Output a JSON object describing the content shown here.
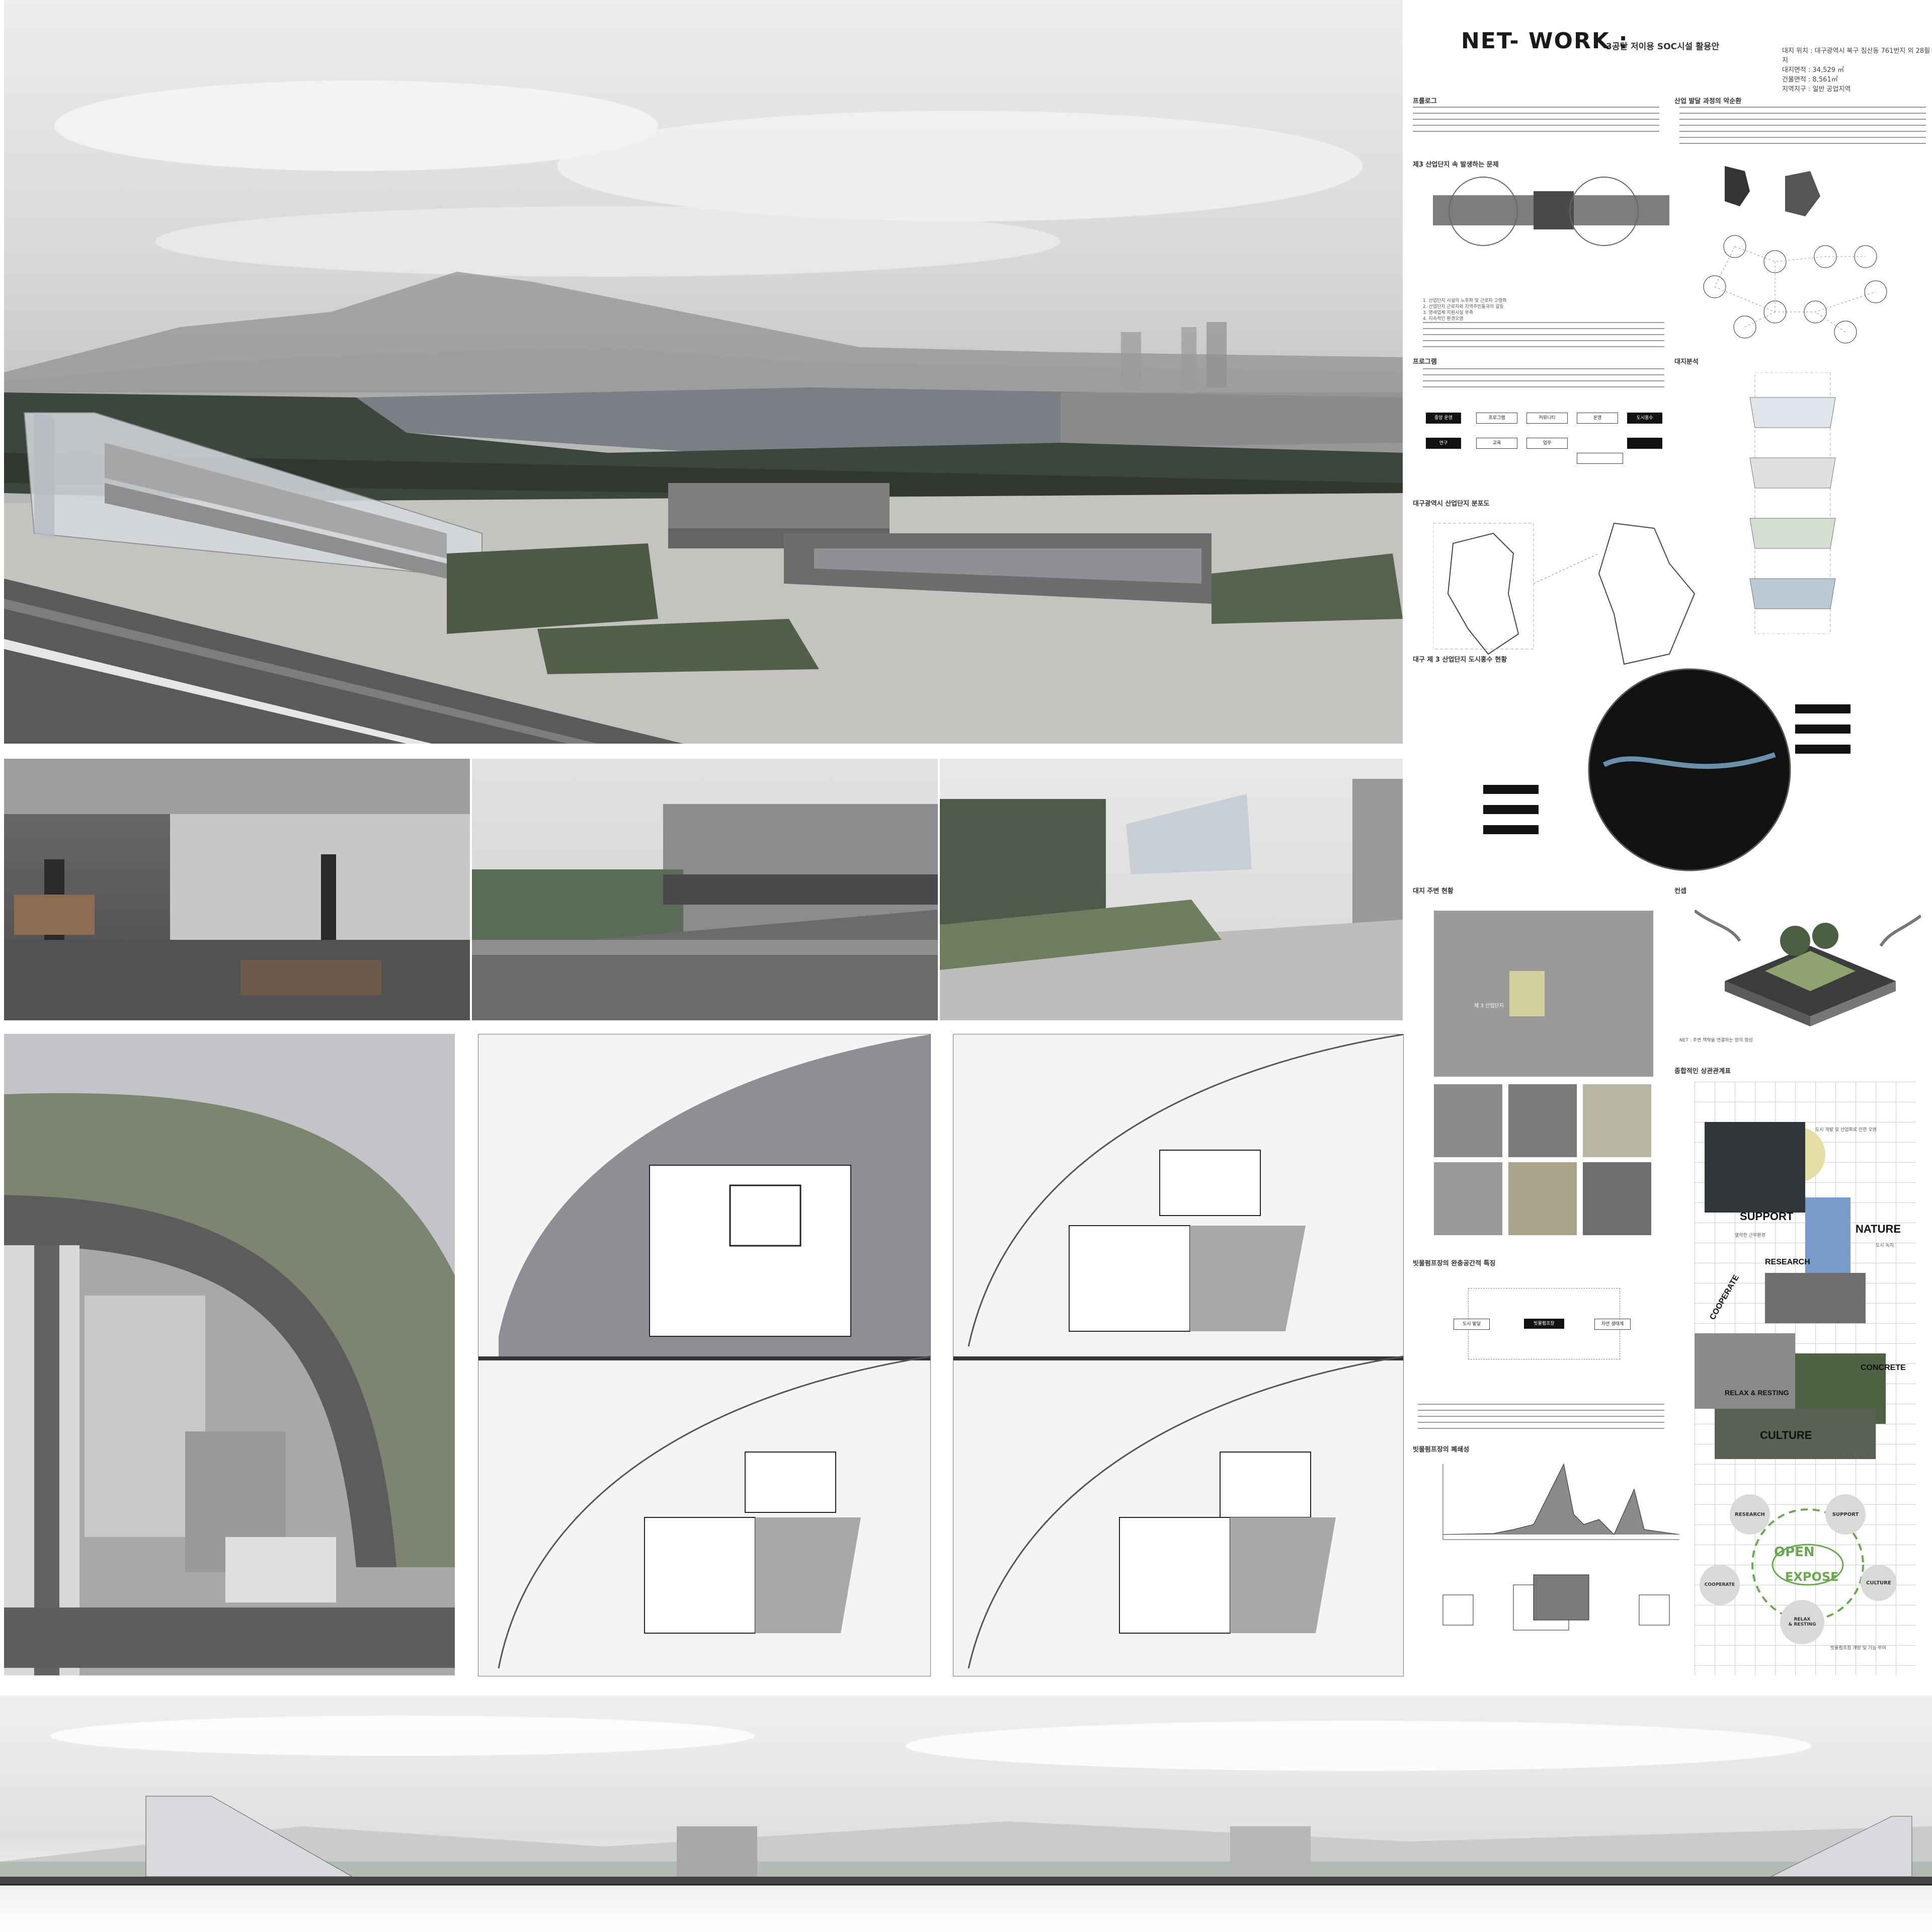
{
  "title": {
    "main": "NET- WORK :",
    "sub": "3공단 저이용 SOC시설 활용안"
  },
  "site_info": [
    "대지 위치 : 대구광역시 북구 침산동 761번지 외 28필지",
    "대지면적 : 34,529 ㎡",
    "건물면적 : 8,561㎡",
    "지역지구 : 일반 공업지역"
  ],
  "sections": {
    "prologue": "프롤로그",
    "industrial_process": "산업 발달 과정의 악순환",
    "problems": "제3 산업단지 속 발생하는 문제",
    "problem_list": [
      "1. 산업단지 시설의 노후화 및 근로자 고령화",
      "2. 산업단지 근로자와 지역주민들과의 갈등",
      "3. 영세업체 지원시설 부족",
      "4. 지속적인 환경오염"
    ],
    "program": "프로그램",
    "site_analysis": "대지분석",
    "distribution_map": "대구광역시 산업단지 분포도",
    "flood_status": "대구 제 3 산업단지 도시홍수 현황",
    "surroundings": "대지 주변 현황",
    "concept": "컨셉",
    "buffer": "빗물펌프장의 완충공간적 특징",
    "closedness": "빗물펌프장의 폐쇄성",
    "comprehensive": "종합적인 상관관계표"
  },
  "program_nodes": [
    "중앙 운영",
    "프로그램",
    "커뮤니티",
    "운영",
    "연구",
    "교육",
    "업무",
    "도시홍수"
  ],
  "buffer_nodes": [
    "도시 발달",
    "빗물펌프장",
    "자연 생태계"
  ],
  "concept_text": "NET : 주변 맥락을 연결하는 망의 형성",
  "collage_words": [
    "SUPPORT",
    "NATURE",
    "RESEARCH",
    "COOPERATE",
    "CONCRETE",
    "RELAX & RESTING",
    "CULTURE"
  ],
  "collage_labels": {
    "urban_dev": "도시 개발 및 산업화로 인한 오염",
    "worker_spaces": "열악한 근무환경",
    "nature_label": "도시 녹지",
    "culture_label": "환경 문화 조성"
  },
  "cycle": {
    "center_top": "OPEN",
    "center_bottom": "EXPOSE",
    "nodes": [
      "RESEARCH",
      "SUPPORT",
      "CULTURE",
      "RELAX\n& RESTING",
      "COOPERATE"
    ],
    "caption": "빗물펌프장 개방 및 기능 부여"
  },
  "map_label": "제 3 산업단지",
  "colors": {
    "accent_yellow": "#d9d6a1",
    "cycle_green": "#6aa84f",
    "water_blue": "#6a8fa8"
  }
}
